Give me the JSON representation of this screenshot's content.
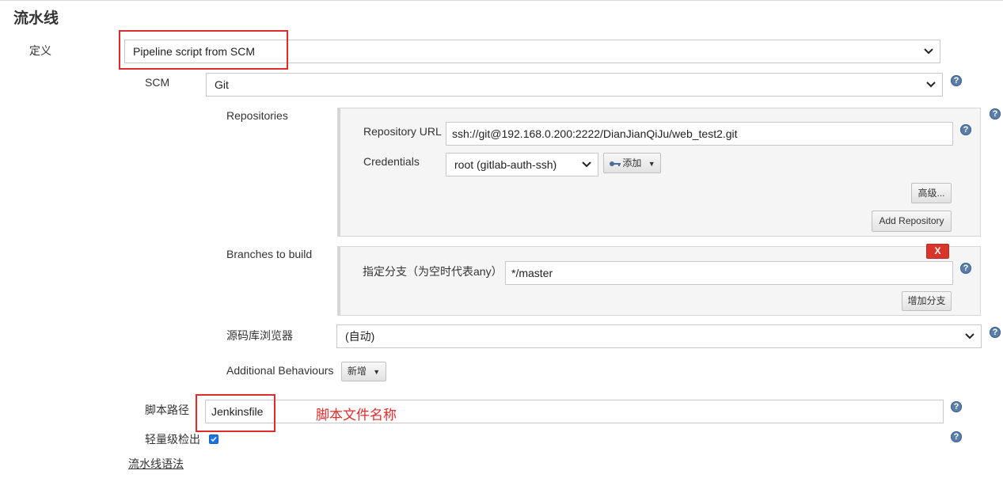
{
  "section": {
    "title": "流水线"
  },
  "definition": {
    "label": "定义",
    "value": "Pipeline script from SCM"
  },
  "scm": {
    "label": "SCM",
    "value": "Git"
  },
  "repositories": {
    "label": "Repositories",
    "url_label": "Repository URL",
    "url_value": "ssh://git@192.168.0.200:2222/DianJianQiJu/web_test2.git",
    "credentials_label": "Credentials",
    "credentials_value": "root (gitlab-auth-ssh)",
    "add_label": "添加",
    "advanced_label": "高级...",
    "add_repository_label": "Add Repository"
  },
  "branches": {
    "label": "Branches to build",
    "remove_label": "X",
    "branch_label": "指定分支（为空时代表any）",
    "branch_value": "*/master",
    "add_branch_label": "增加分支"
  },
  "browser": {
    "label": "源码库浏览器",
    "value": "(自动)"
  },
  "behaviours": {
    "label": "Additional Behaviours",
    "add_label": "新增"
  },
  "script_path": {
    "label": "脚本路径",
    "value": "Jenkinsfile"
  },
  "annotation": "脚本文件名称",
  "lightweight": {
    "label": "轻量级检出",
    "checked": true
  },
  "syntax_link": "流水线语法",
  "colors": {
    "annotation_red": "#e02b2b",
    "help_blue": "#5a7ea8",
    "delete_red": "#d9352a",
    "checkbox_blue": "#1a73e8"
  }
}
